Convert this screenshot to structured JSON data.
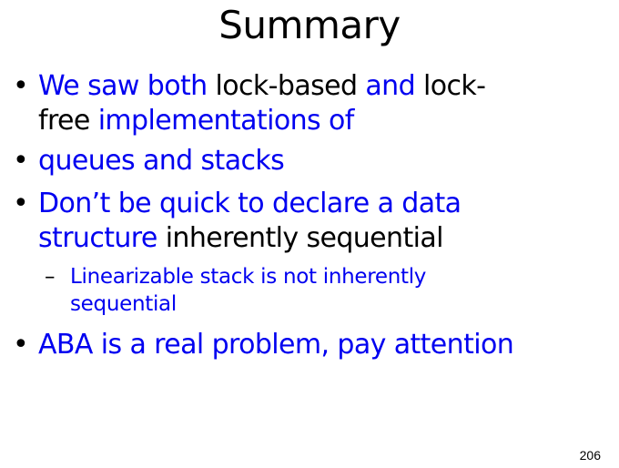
{
  "slide": {
    "title": "Summary",
    "page_number": "206",
    "colors": {
      "emphasis": "#0000f0",
      "normal": "#000000"
    },
    "bullets": [
      {
        "line1": {
          "s1": "We saw both ",
          "s2": "lock-based ",
          "s3": "and ",
          "s4": "lock-"
        },
        "line2": {
          "s1": "free ",
          "s2": "implementations of"
        }
      },
      {
        "line1": {
          "s1": "queues and stacks"
        }
      },
      {
        "line1": {
          "s1": "Don’t be quick to declare a data"
        },
        "line2": {
          "s1": "structure ",
          "s2": "inherently sequential"
        },
        "sub": {
          "line1": "Linearizable stack is not inherently",
          "line2": "sequential"
        }
      },
      {
        "line1": {
          "s1": "ABA is a real problem, pay attention"
        }
      }
    ]
  }
}
